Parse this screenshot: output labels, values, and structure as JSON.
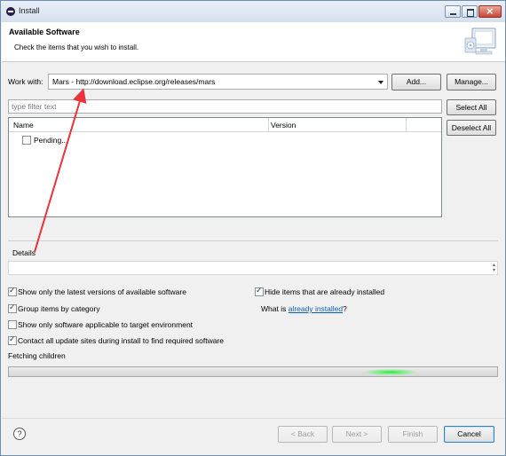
{
  "window": {
    "title": "Install",
    "controls": {
      "minimize": "minimize",
      "maximize": "maximize",
      "close": "close"
    }
  },
  "header": {
    "title": "Available Software",
    "subtitle": "Check the items that you wish to install."
  },
  "work_with": {
    "label": "Work with:",
    "value": "Mars - http://download.eclipse.org/releases/mars",
    "add_label": "Add...",
    "manage_label": "Manage..."
  },
  "filter": {
    "placeholder": "type filter text"
  },
  "side_buttons": {
    "select_all": "Select All",
    "deselect_all": "Deselect All"
  },
  "table": {
    "columns": [
      "Name",
      "Version"
    ],
    "rows": [
      {
        "name": "Pending...",
        "checked": false
      }
    ]
  },
  "details": {
    "label": "Details",
    "value": ""
  },
  "options": {
    "latest_versions": {
      "label": "Show only the latest versions of available software",
      "checked": true
    },
    "group_by_category": {
      "label": "Group items by category",
      "checked": true
    },
    "target_env": {
      "label": "Show only software applicable to target environment",
      "checked": false
    },
    "contact_sites": {
      "label": "Contact all update sites during install to find required software",
      "checked": true
    },
    "hide_installed": {
      "label": "Hide items that are already installed",
      "checked": true
    },
    "what_is_prefix": "What is ",
    "what_is_link": "already installed",
    "what_is_suffix": "?"
  },
  "status": {
    "text": "Fetching children"
  },
  "footer": {
    "help": "?",
    "back": "< Back",
    "next": "Next >",
    "finish": "Finish",
    "cancel": "Cancel"
  },
  "colors": {
    "annotation_arrow": "#e8343a",
    "link": "#0b5fb3",
    "progress_glow": "#34e04a"
  }
}
